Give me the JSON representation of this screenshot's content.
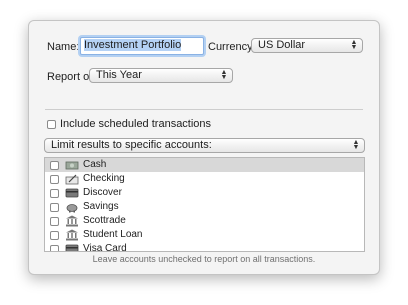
{
  "form": {
    "name_label": "Name:",
    "name_value": "Investment Portfolio",
    "currency_label": "Currency:",
    "currency_value": "US Dollar",
    "report_on_label": "Report on",
    "report_on_value": "This Year",
    "include_scheduled_label": "Include scheduled transactions",
    "include_scheduled_checked": false,
    "limit_value": "Limit results to specific accounts:"
  },
  "accounts": [
    {
      "label": "Cash",
      "icon": "cash-icon",
      "checked": false,
      "selected": true
    },
    {
      "label": "Checking",
      "icon": "checkbook-icon",
      "checked": false,
      "selected": false
    },
    {
      "label": "Discover",
      "icon": "credit-card-icon",
      "checked": false,
      "selected": false
    },
    {
      "label": "Savings",
      "icon": "piggy-bank-icon",
      "checked": false,
      "selected": false
    },
    {
      "label": "Scottrade",
      "icon": "bank-building-icon",
      "checked": false,
      "selected": false
    },
    {
      "label": "Student Loan",
      "icon": "bank-building-icon",
      "checked": false,
      "selected": false
    },
    {
      "label": "Visa Card",
      "icon": "credit-card-icon",
      "checked": false,
      "selected": false
    }
  ],
  "footer_note": "Leave accounts unchecked to report on all transactions.",
  "colors": {
    "accent": "#8ab2e4",
    "selection": "#b5d2f5",
    "row_selected": "#d8d8d8"
  }
}
